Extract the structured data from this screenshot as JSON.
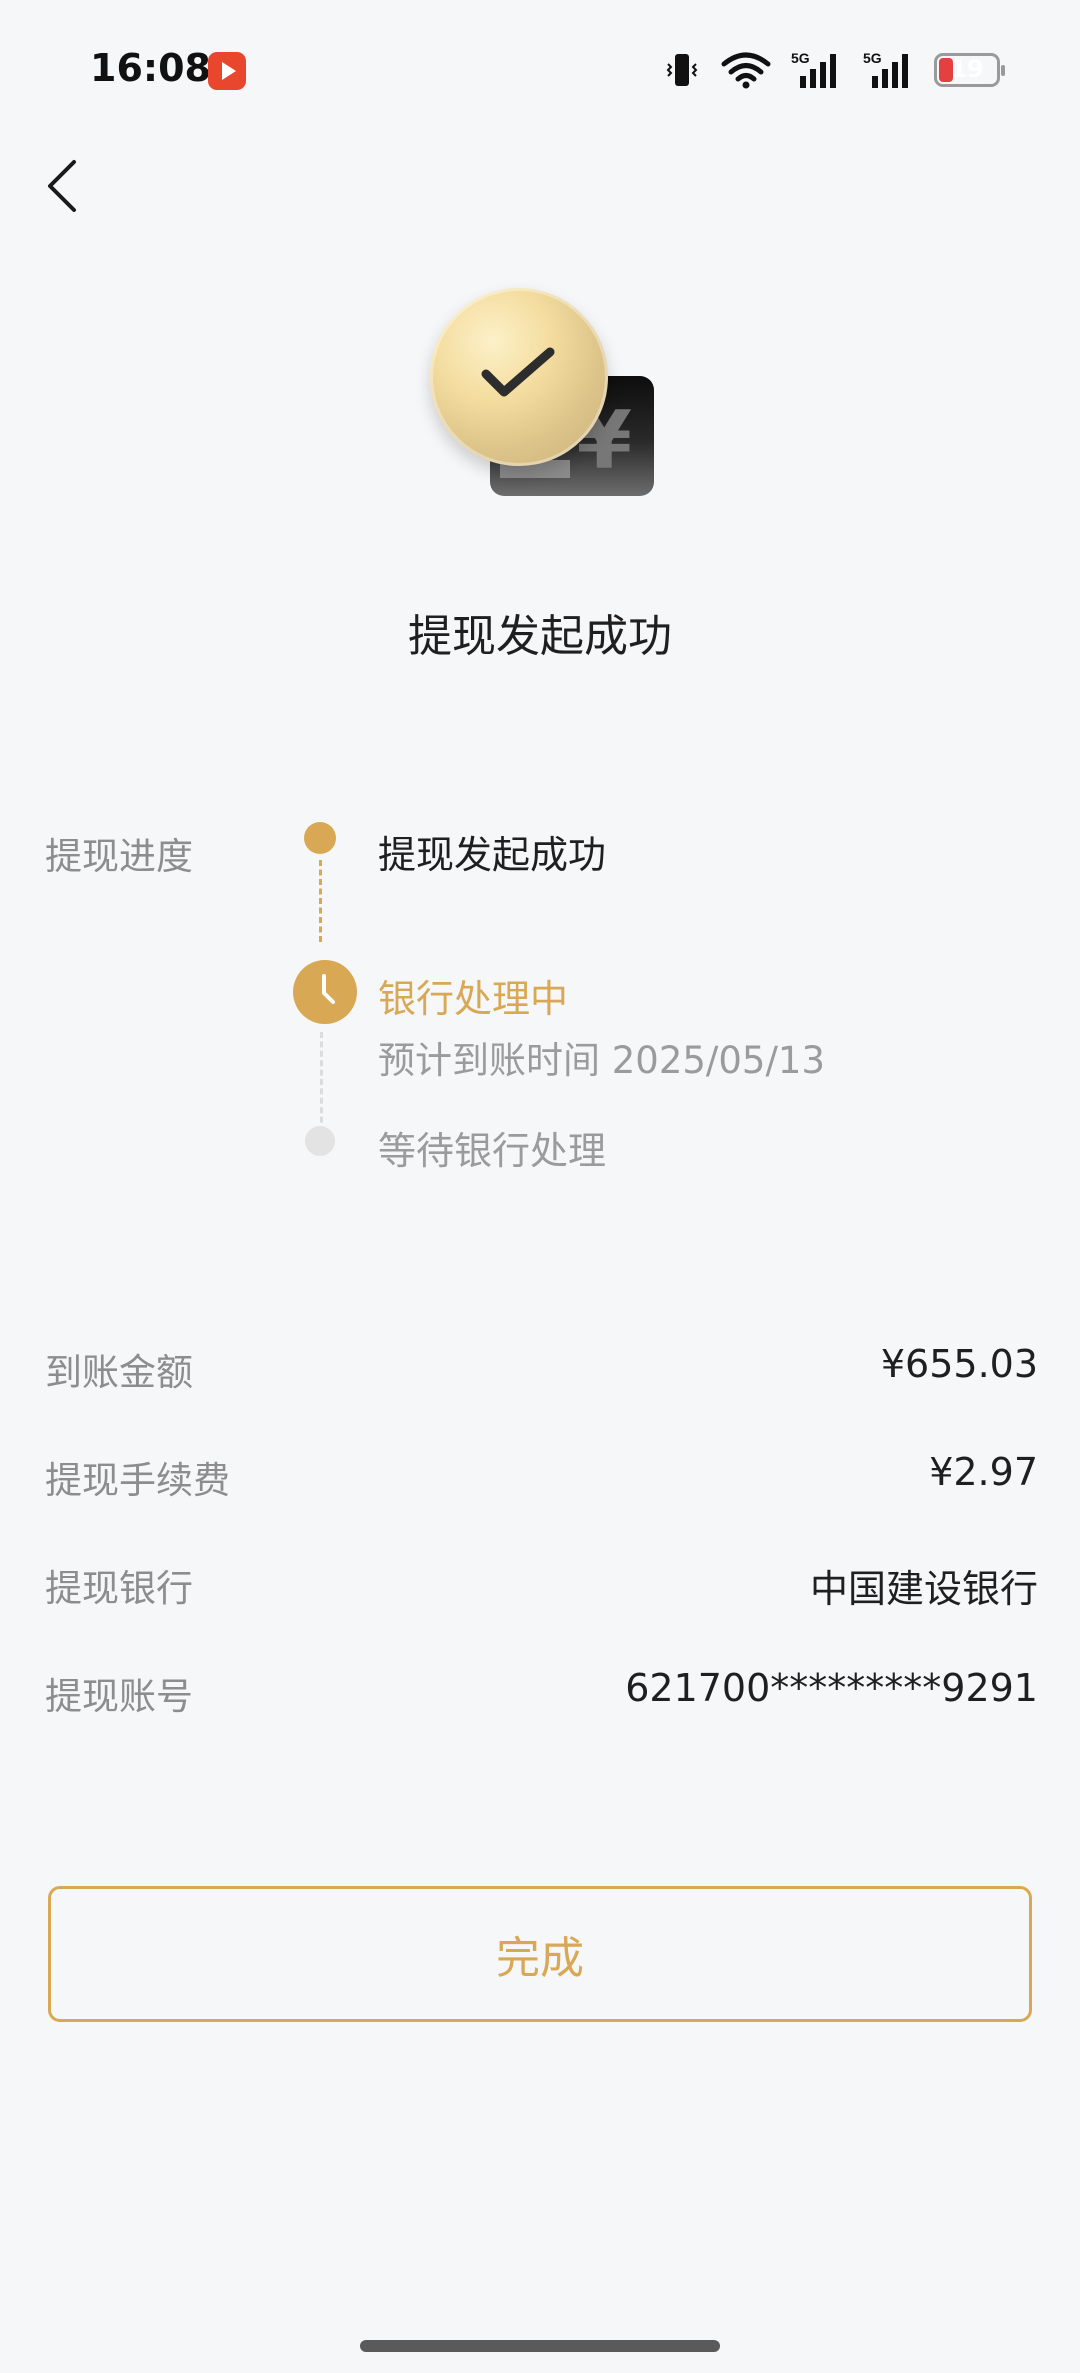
{
  "status_bar": {
    "time": "16:08",
    "battery_level": "19",
    "network_labels": [
      "5G",
      "5G"
    ]
  },
  "page": {
    "title": "提现发起成功"
  },
  "progress": {
    "label": "提现进度",
    "steps": [
      {
        "title": "提现发起成功",
        "state": "done"
      },
      {
        "title": "银行处理中",
        "subtitle": "预计到账时间 2025/05/13",
        "state": "current"
      },
      {
        "title": "等待银行处理",
        "state": "pending"
      }
    ]
  },
  "details": [
    {
      "label": "到账金额",
      "value": "¥655.03"
    },
    {
      "label": "提现手续费",
      "value": "¥2.97"
    },
    {
      "label": "提现银行",
      "value": "中国建设银行"
    },
    {
      "label": "提现账号",
      "value": "621700*********9291"
    }
  ],
  "actions": {
    "done_label": "完成"
  },
  "colors": {
    "accent": "#d9a855",
    "background": "#f6f7f9",
    "battery_low": "#e54040"
  },
  "icons": {
    "back": "chevron-left-icon",
    "hero": "checkmark-coin-card-icon",
    "current_step": "clock-icon"
  }
}
